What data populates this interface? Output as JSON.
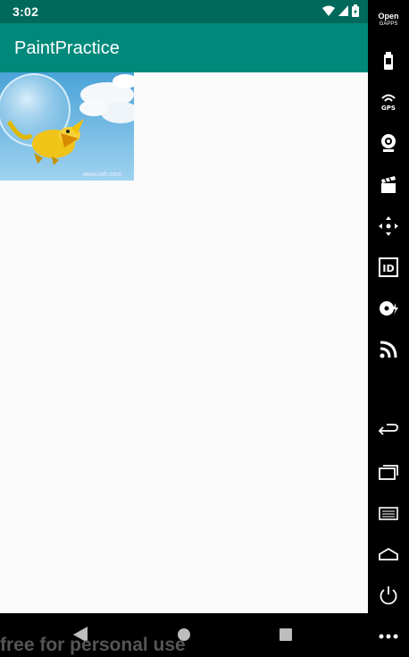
{
  "status_bar": {
    "time": "3:02"
  },
  "app_bar": {
    "title": "PaintPractice"
  },
  "content": {
    "image_watermark": "www.ioth.com"
  },
  "nav_bar": {
    "overlay_text": "free for personal use"
  },
  "sidebar": {
    "open_label_line1": "Open",
    "open_label_line2": "GAPPS",
    "items": [
      "battery-icon",
      "gps-icon",
      "camera-icon",
      "clapperboard-icon",
      "move-icon",
      "id-icon",
      "disc-icon",
      "rss-icon",
      "back-icon",
      "recents-icon",
      "menu-icon",
      "home-icon",
      "power-icon",
      "more-icon"
    ]
  },
  "colors": {
    "status_bar": "#00695c",
    "app_bar": "#00897b",
    "background": "#fafafa"
  }
}
